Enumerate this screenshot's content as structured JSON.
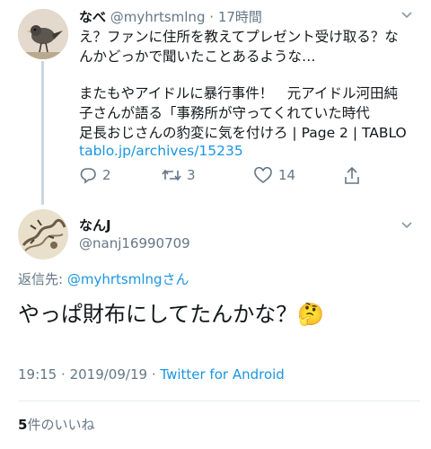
{
  "parent_tweet": {
    "name": "なべ",
    "handle": "@myhrtsmlng",
    "separator": "·",
    "time": "17時間",
    "text_line1": "え？ファンに住所を教えてプレゼント受け取る？な",
    "text_line2": "んかどっかで聞いたことあるような…",
    "link_title1": "またもやアイドルに暴行事件！　元アイドル河田純",
    "link_title2": "子さんが語る「事務所が守ってくれていた時代",
    "link_title3": "足長おじさんの豹変に気を付けろ | Page 2 | TABLO",
    "url": "tablo.jp/archives/15235",
    "actions": {
      "replies": "2",
      "retweets": "3",
      "likes": "14"
    }
  },
  "main_tweet": {
    "name": "なんJ",
    "handle": "@nanj16990709",
    "reply_to_prefix": "返信先:",
    "reply_to_handle": "@myhrtsmlngさん",
    "text": "やっぱ財布にしてたんかな？",
    "emoji": "🤔",
    "time": "19:15",
    "date_sep": "·",
    "date": "2019/09/19",
    "source_sep": "·",
    "source": "Twitter for Android"
  },
  "likes": {
    "count": "5",
    "label": "件のいいね"
  },
  "colors": {
    "link": "#1b95e0",
    "muted": "#657786",
    "text": "#14171a",
    "divider": "#e6ecf0",
    "thread": "#ccd6dd"
  }
}
